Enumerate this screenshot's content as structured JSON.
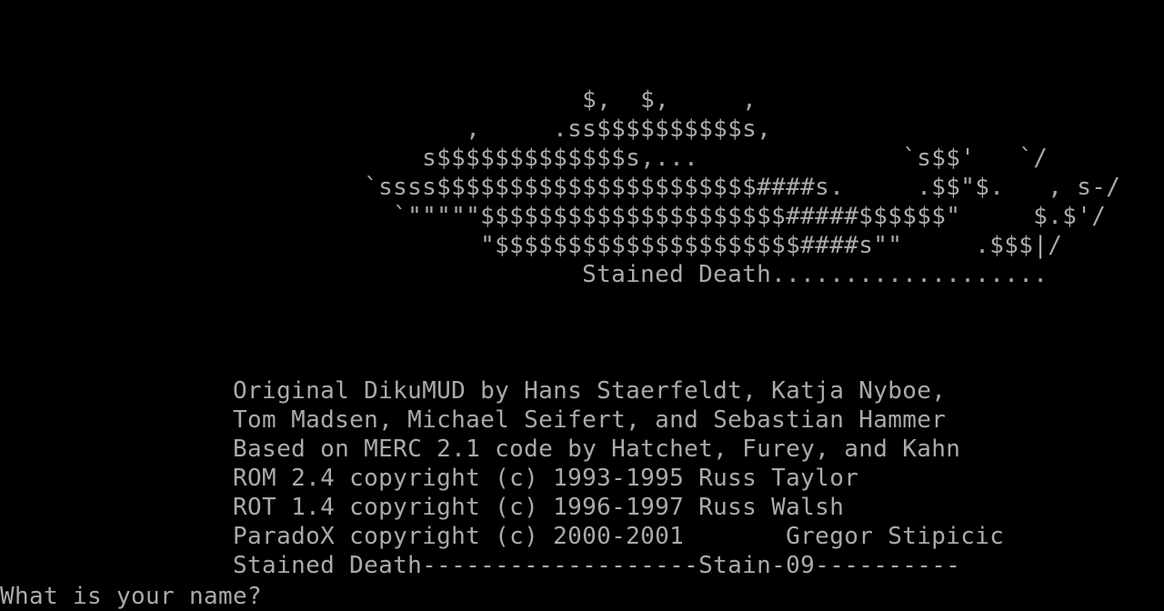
{
  "screen": {
    "background_color": "#000000",
    "text_color": "#aaaaaa"
  },
  "ascii_art": {
    "lines": [
      "                                        $,  $,     ,",
      "                                ,     .ss$$$$$$$$$$s,",
      "                             s$$$$$$$$$$$$$s,...              `s$$'   `/",
      "                         `ssss$$$$$$$$$$$$$$$$$$$$$$####s.     .$$\"$.   , s-/",
      "                           `\"\"\"\"\"$$$$$$$$$$$$$$$$$$$$$#####$$$$$$\"     $.$'/",
      "                                 \"$$$$$$$$$$$$$$$$$$$$$####s\"\"     .$$$|/",
      "                                        Stained Death..................."
    ]
  },
  "credits": {
    "lines": [
      "                Original DikuMUD by Hans Staerfeldt, Katja Nyboe,",
      "                Tom Madsen, Michael Seifert, and Sebastian Hammer",
      "                Based on MERC 2.1 code by Hatchet, Furey, and Kahn",
      "                ROM 2.4 copyright (c) 1993-1995 Russ Taylor",
      "                ROT 1.4 copyright (c) 1996-1997 Russ Walsh",
      "                ParadoX copyright (c) 2000-2001       Gregor Stipicic",
      "                Stained Death-------------------Stain-09----------"
    ]
  },
  "prompt": {
    "text": "What is your name? "
  }
}
